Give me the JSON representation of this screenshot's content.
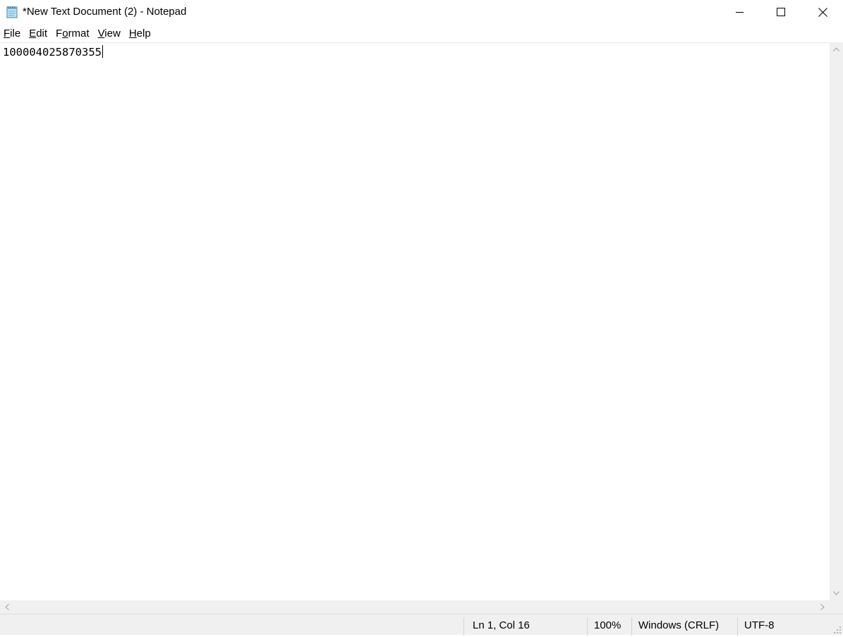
{
  "window": {
    "title": "*New Text Document (2) - Notepad",
    "icon": "notepad-icon",
    "controls": {
      "minimize": "minimize-icon",
      "maximize": "maximize-icon",
      "close": "close-icon"
    }
  },
  "menu": {
    "items": [
      {
        "label_pre": "",
        "label_u": "F",
        "label_post": "ile"
      },
      {
        "label_pre": "",
        "label_u": "E",
        "label_post": "dit"
      },
      {
        "label_pre": "F",
        "label_u": "o",
        "label_post": "rmat"
      },
      {
        "label_pre": "",
        "label_u": "V",
        "label_post": "iew"
      },
      {
        "label_pre": "",
        "label_u": "H",
        "label_post": "elp"
      }
    ]
  },
  "editor": {
    "content": "100004025870355"
  },
  "status": {
    "position": "Ln 1, Col 16",
    "zoom": "100%",
    "line_ending": "Windows (CRLF)",
    "encoding": "UTF-8"
  }
}
